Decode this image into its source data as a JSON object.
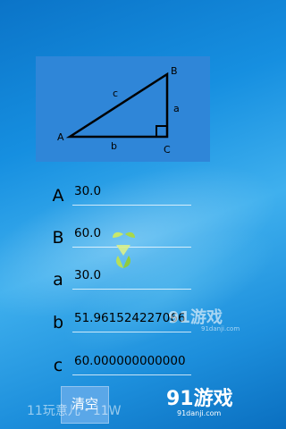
{
  "diagram": {
    "vertices": {
      "a": "A",
      "b": "B",
      "c": "C"
    },
    "sides": {
      "a": "a",
      "b": "b",
      "c": "c"
    }
  },
  "rows": [
    {
      "label": "A",
      "value": "30.0"
    },
    {
      "label": "B",
      "value": "60.0"
    },
    {
      "label": "a",
      "value": "30.0"
    },
    {
      "label": "b",
      "value": "51.961524227066"
    },
    {
      "label": "c",
      "value": "60.000000000000"
    }
  ],
  "buttons": {
    "clear": "清空"
  },
  "watermarks": {
    "bottom_text": "11玩意儿・11W",
    "logo_main": "91游戏",
    "logo_site": "91danji.com"
  }
}
